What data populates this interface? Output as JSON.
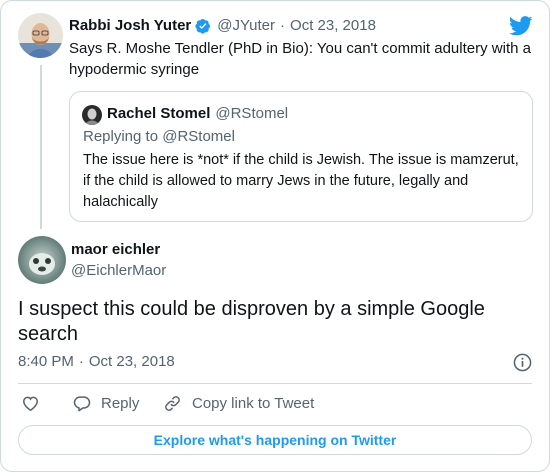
{
  "parent_tweet": {
    "author_name": "Rabbi Josh Yuter",
    "handle": "@JYuter",
    "separator": "·",
    "date": "Oct 23, 2018",
    "text": "Says R. Moshe Tendler (PhD in Bio): You can't commit adultery with a hypodermic syringe",
    "quoted": {
      "author_name": "Rachel Stomel",
      "handle": "@RStomel",
      "replying_to": "Replying to @RStomel",
      "text": "The issue here is *not* if the child is Jewish. The issue is mamzerut, if the child is allowed to marry Jews in the future, legally and halachically"
    }
  },
  "main_tweet": {
    "author_name": "maor eichler",
    "handle": "@EichlerMaor",
    "text": "I suspect this could be disproven by a simple Google search",
    "time": "8:40 PM",
    "separator": "·",
    "date": "Oct 23, 2018"
  },
  "actions": {
    "reply_label": "Reply",
    "copy_link_label": "Copy link to Tweet"
  },
  "explore_label": "Explore what's happening on Twitter",
  "icons": {
    "brand": "twitter-bird-icon",
    "verified": "verified-badge-icon",
    "info": "info-icon",
    "like": "heart-icon",
    "reply": "speech-bubble-icon",
    "copy_link": "link-icon"
  },
  "colors": {
    "brand_blue": "#1d9bf0",
    "text": "#0f1419",
    "secondary_text": "#536471",
    "border": "#cfd9de"
  }
}
